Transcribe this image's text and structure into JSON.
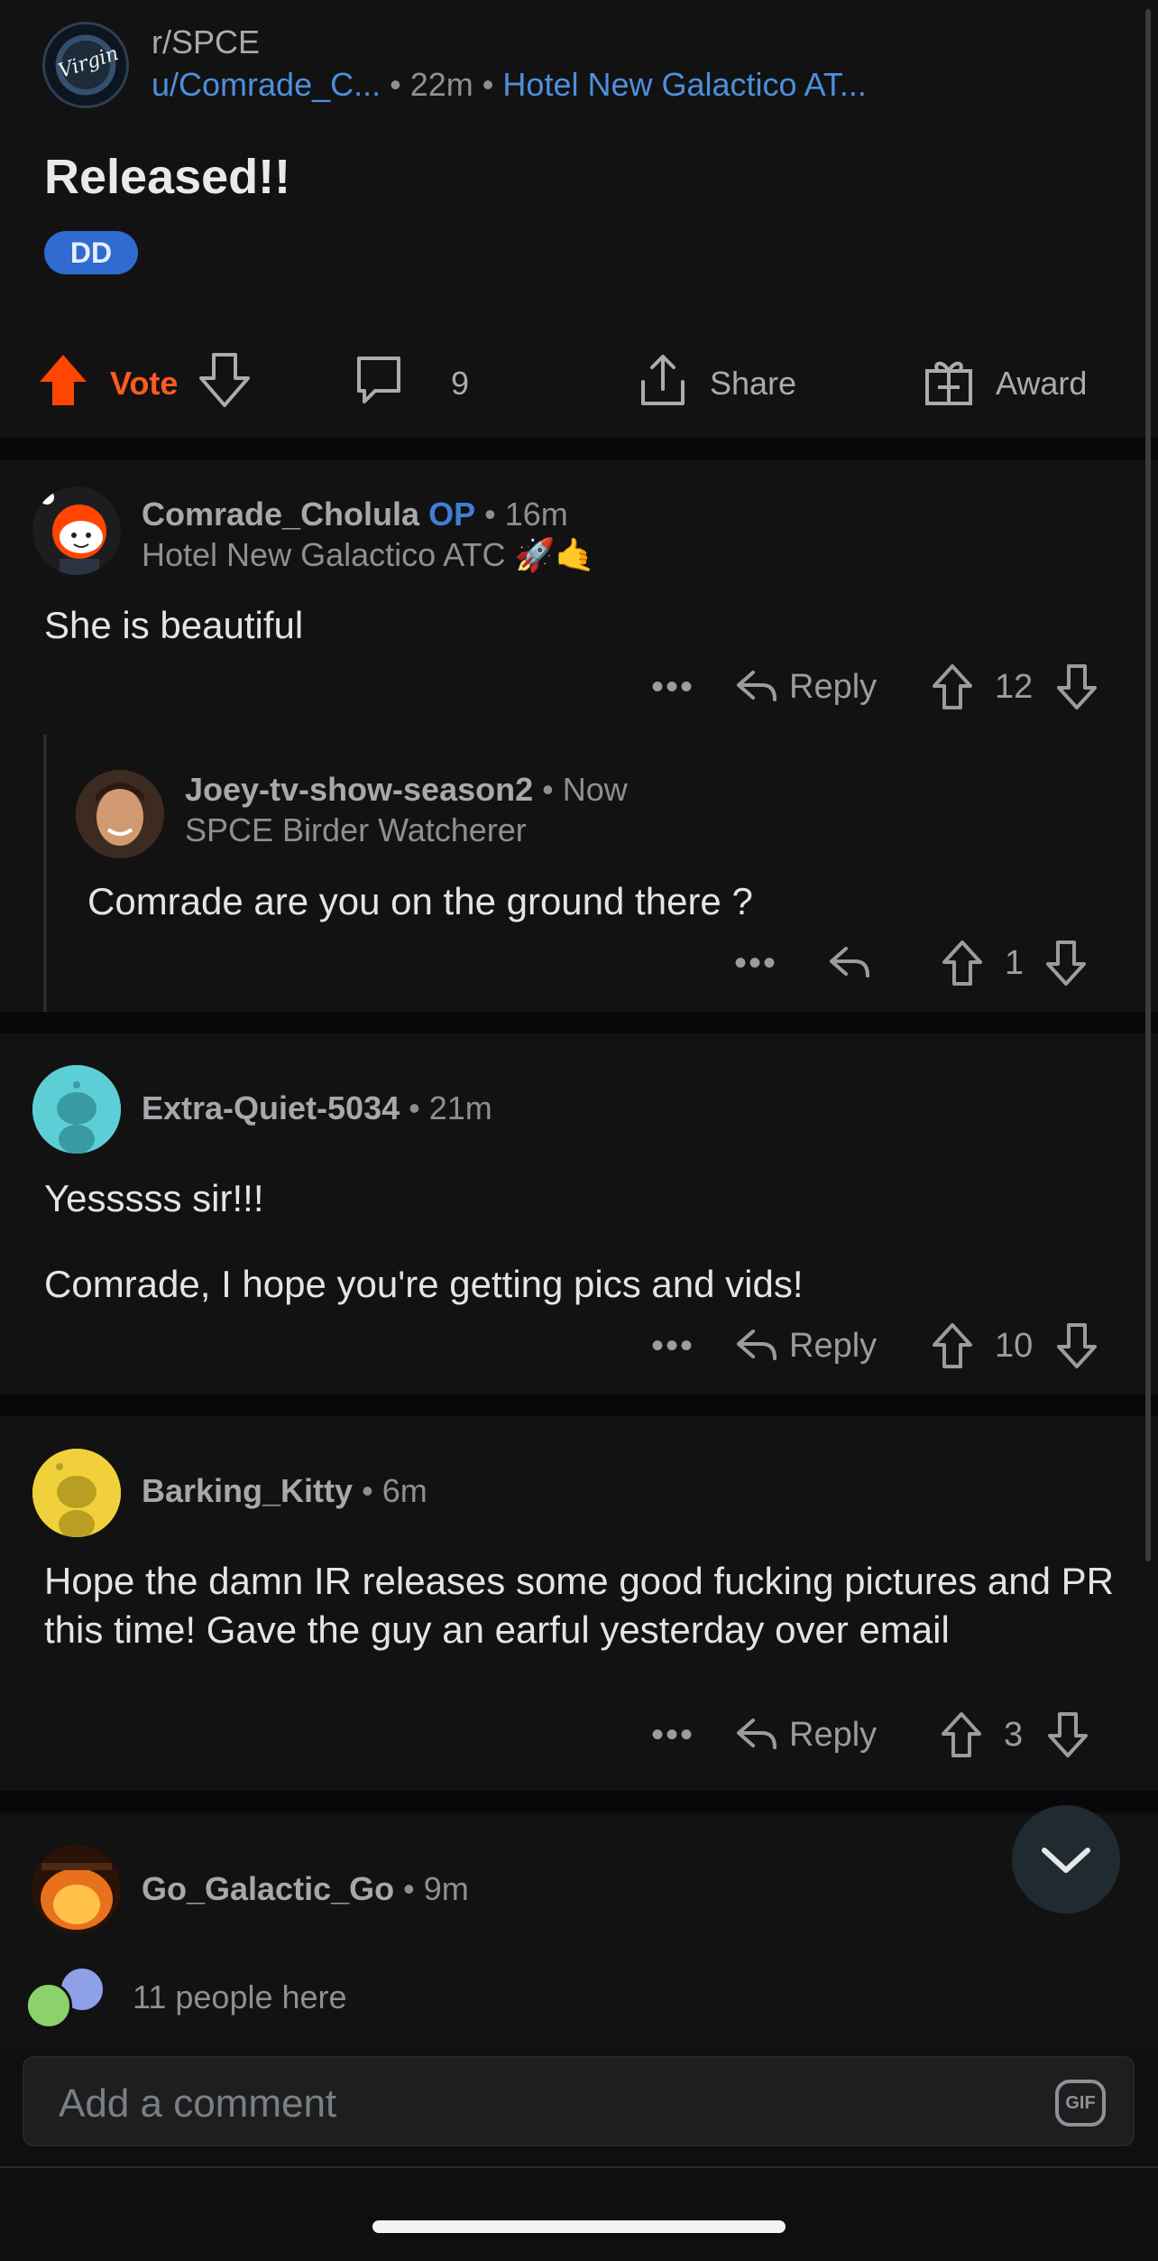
{
  "post": {
    "subreddit": "r/SPCE",
    "author": "u/Comrade_C...",
    "dot": "•",
    "time": "22m",
    "author_flair": "Hotel New Galactico AT...",
    "title": "Released!!",
    "flair_badge": "DD",
    "actions": {
      "vote_label": "Vote",
      "comments_count": "9",
      "share_label": "Share",
      "award_label": "Award"
    }
  },
  "comments": [
    {
      "username": "Comrade_Cholula",
      "op_tag": "OP",
      "time": "16m",
      "flair": "Hotel New Galactico ATC 🚀🤙",
      "body": "She is beautiful",
      "reply_label": "Reply",
      "score": "12",
      "more": "•••"
    },
    {
      "username": "Joey-tv-show-season2",
      "time": "Now",
      "flair": "SPCE Birder Watcherer",
      "body": "Comrade are you on the ground there ?",
      "score": "1",
      "more": "•••"
    },
    {
      "username": "Extra-Quiet-5034",
      "time": "21m",
      "body_lines": [
        "Yesssss sir!!!",
        "Comrade, I hope you're getting pics and vids!"
      ],
      "reply_label": "Reply",
      "score": "10",
      "more": "•••"
    },
    {
      "username": "Barking_Kitty",
      "time": "6m",
      "body": "Hope the damn IR releases some good fucking pictures and PR this time! Gave the guy an earful yesterday over email",
      "reply_label": "Reply",
      "score": "3",
      "more": "•••"
    },
    {
      "username": "Go_Galactic_Go",
      "time": "9m"
    }
  ],
  "presence": {
    "text": "11 people here"
  },
  "composer": {
    "placeholder": "Add a comment",
    "gif_label": "GIF"
  },
  "colors": {
    "accent_orange": "#ff5a1f",
    "link_blue": "#4e8fdb",
    "op_blue": "#3f7fd8",
    "background": "#121213"
  }
}
